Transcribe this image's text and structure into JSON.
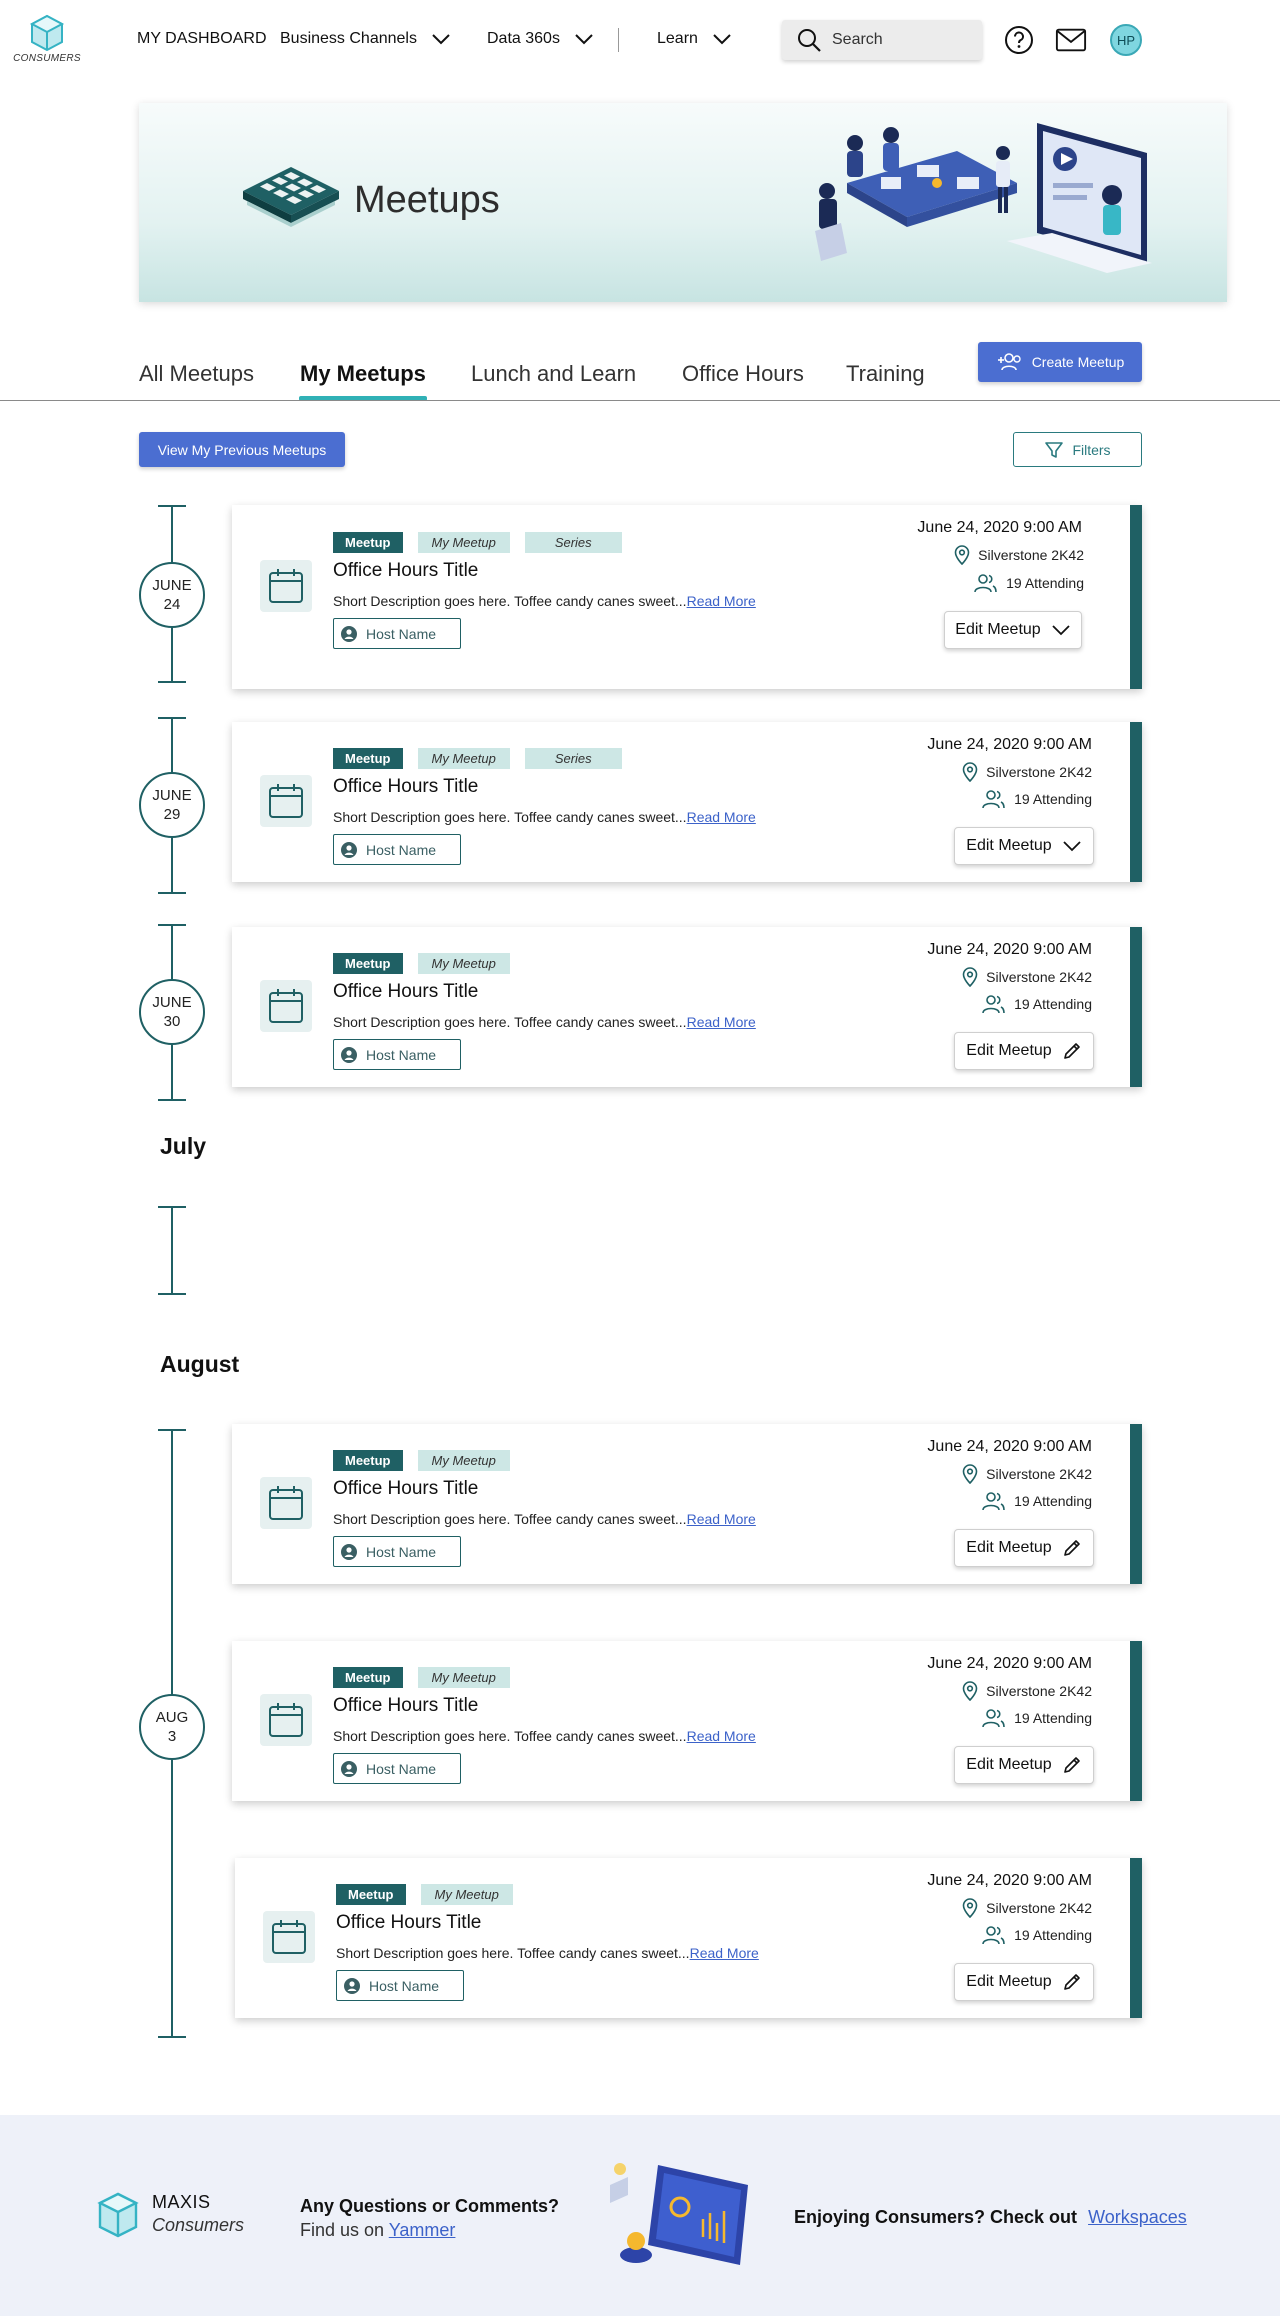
{
  "header": {
    "logo_text": "CONSUMERS",
    "nav": [
      {
        "label": "MY DASHBOARD"
      },
      {
        "label": "Business Channels"
      },
      {
        "label": "Data 360s"
      },
      {
        "label": "Learn"
      }
    ],
    "search_placeholder": "Search",
    "avatar_initials": "HP"
  },
  "banner": {
    "title": "Meetups"
  },
  "tabs": [
    {
      "label": "All Meetups",
      "active": false
    },
    {
      "label": "My Meetups",
      "active": true
    },
    {
      "label": "Lunch and Learn",
      "active": false
    },
    {
      "label": "Office Hours",
      "active": false
    },
    {
      "label": "Training",
      "active": false
    }
  ],
  "actions": {
    "create_label": "Create Meetup",
    "previous_label": "View My Previous Meetups",
    "filters_label": "Filters"
  },
  "timeline": {
    "dates": [
      {
        "month": "JUNE",
        "day": "24"
      },
      {
        "month": "JUNE",
        "day": "29"
      },
      {
        "month": "JUNE",
        "day": "30"
      },
      {
        "month": "AUG",
        "day": "3"
      }
    ],
    "months": [
      "July",
      "August"
    ]
  },
  "cards": [
    {
      "badges": [
        "Meetup",
        "My Meetup",
        "Series"
      ],
      "title": "Office Hours Title",
      "description": "Short Description goes here. Toffee candy canes sweet...",
      "read_more": "Read More",
      "host": "Host Name",
      "datetime": "June 24, 2020 9:00 AM",
      "location": "Silverstone 2K42",
      "attending": "19 Attending",
      "edit_label": "Edit Meetup",
      "edit_icon": "chevron-down-icon"
    },
    {
      "badges": [
        "Meetup",
        "My Meetup",
        "Series"
      ],
      "title": "Office Hours Title",
      "description": "Short Description goes here. Toffee candy canes sweet...",
      "read_more": "Read More",
      "host": "Host Name",
      "datetime": "June 24, 2020 9:00 AM",
      "location": "Silverstone 2K42",
      "attending": "19 Attending",
      "edit_label": "Edit Meetup",
      "edit_icon": "chevron-down-icon"
    },
    {
      "badges": [
        "Meetup",
        "My Meetup"
      ],
      "title": "Office Hours Title",
      "description": "Short Description goes here. Toffee candy canes sweet...",
      "read_more": "Read More",
      "host": "Host Name",
      "datetime": "June 24, 2020 9:00 AM",
      "location": "Silverstone 2K42",
      "attending": "19 Attending",
      "edit_label": "Edit Meetup",
      "edit_icon": "pencil-icon"
    },
    {
      "badges": [
        "Meetup",
        "My Meetup"
      ],
      "title": "Office Hours Title",
      "description": "Short Description goes here. Toffee candy canes sweet...",
      "read_more": "Read More",
      "host": "Host Name",
      "datetime": "June 24, 2020 9:00 AM",
      "location": "Silverstone 2K42",
      "attending": "19 Attending",
      "edit_label": "Edit Meetup",
      "edit_icon": "pencil-icon"
    },
    {
      "badges": [
        "Meetup",
        "My Meetup"
      ],
      "title": "Office Hours Title",
      "description": "Short Description goes here. Toffee candy canes sweet...",
      "read_more": "Read More",
      "host": "Host Name",
      "datetime": "June 24, 2020 9:00 AM",
      "location": "Silverstone 2K42",
      "attending": "19 Attending",
      "edit_label": "Edit Meetup",
      "edit_icon": "pencil-icon"
    },
    {
      "badges": [
        "Meetup",
        "My Meetup"
      ],
      "title": "Office Hours Title",
      "description": "Short Description goes here. Toffee candy canes sweet...",
      "read_more": "Read More",
      "host": "Host Name",
      "datetime": "June 24, 2020 9:00 AM",
      "location": "Silverstone 2K42",
      "attending": "19 Attending",
      "edit_label": "Edit Meetup",
      "edit_icon": "pencil-icon"
    }
  ],
  "footer": {
    "brand_line1": "MAXIS",
    "brand_line2": "Consumers",
    "question": "Any Questions or Comments?",
    "find_us_prefix": "Find us on",
    "find_us_link": "Yammer",
    "enjoy_text": "Enjoying Consumers? Check out",
    "enjoy_link": "Workspaces"
  },
  "colors": {
    "primary_blue": "#4b6ed1",
    "teal_dark": "#1f6064",
    "teal_accent": "#30b1b6",
    "badge_light": "#cde7e5",
    "link": "#3c62c9"
  }
}
